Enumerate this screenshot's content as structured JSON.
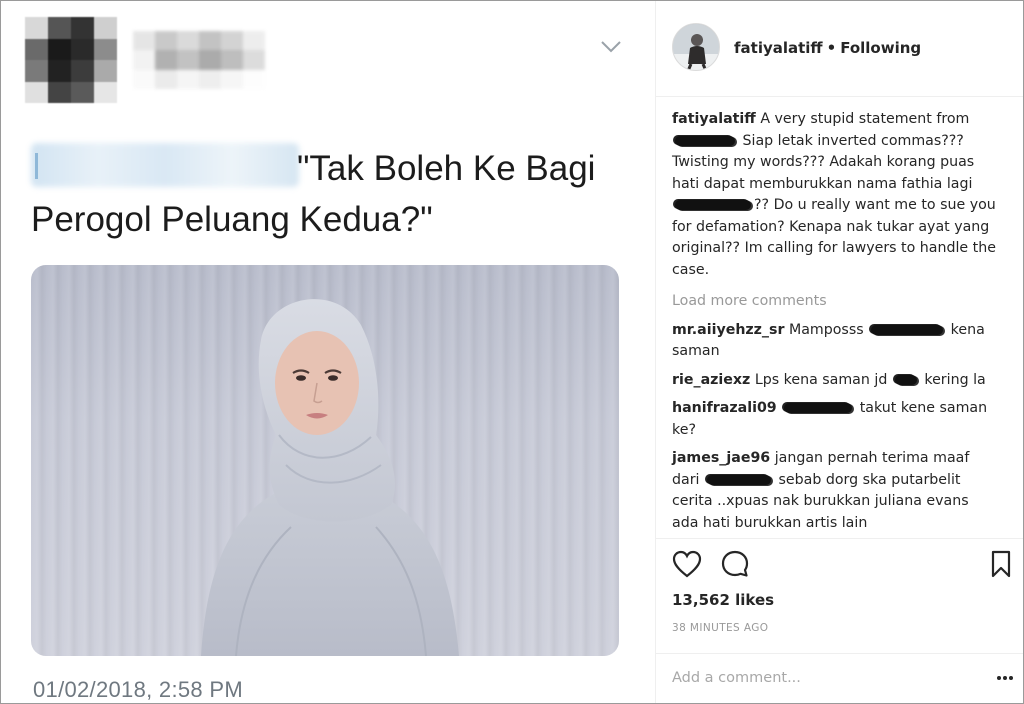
{
  "tweet": {
    "text": "\"Tak Boleh Ke Bagi Perogol Peluang Kedua?\"",
    "timestamp": "01/02/2018, 2:58 PM",
    "caret_icon": "chevron-down-icon"
  },
  "instagram": {
    "header": {
      "username": "fatiyalatiff",
      "separator": "•",
      "status": "Following"
    },
    "caption": {
      "username": "fatiyalatiff",
      "part1": "A very stupid statement from",
      "part2": "Siap letak inverted commas??? Twisting my words??? Adakah korang puas hati dapat memburukkan nama fathia lagi",
      "part3": "?? Do u really want me to sue you for defamation? Kenapa nak tukar ayat yang original?? Im calling for lawyers to handle the case."
    },
    "load_more": "Load more comments",
    "comments": [
      {
        "username": "mr.aiiyehzz_sr",
        "before": "Mamposss",
        "after": "kena saman"
      },
      {
        "username": "rie_aziexz",
        "before": "Lps kena saman jd",
        "after": "kering la"
      },
      {
        "username": "hanifrazali09",
        "before": "",
        "after": "takut kene saman ke?"
      },
      {
        "username": "james_jae96",
        "before": "jangan pernah terima maaf dari",
        "after": "sebab dorg ska putarbelit cerita ..xpuas nak burukkan juliana evans ada hati burukkan artis lain"
      }
    ],
    "likes": "13,562 likes",
    "time_ago": "38 MINUTES AGO",
    "add_comment_placeholder": "Add a comment...",
    "icons": [
      "heart-icon",
      "comment-icon",
      "bookmark-icon",
      "more-icon"
    ]
  }
}
